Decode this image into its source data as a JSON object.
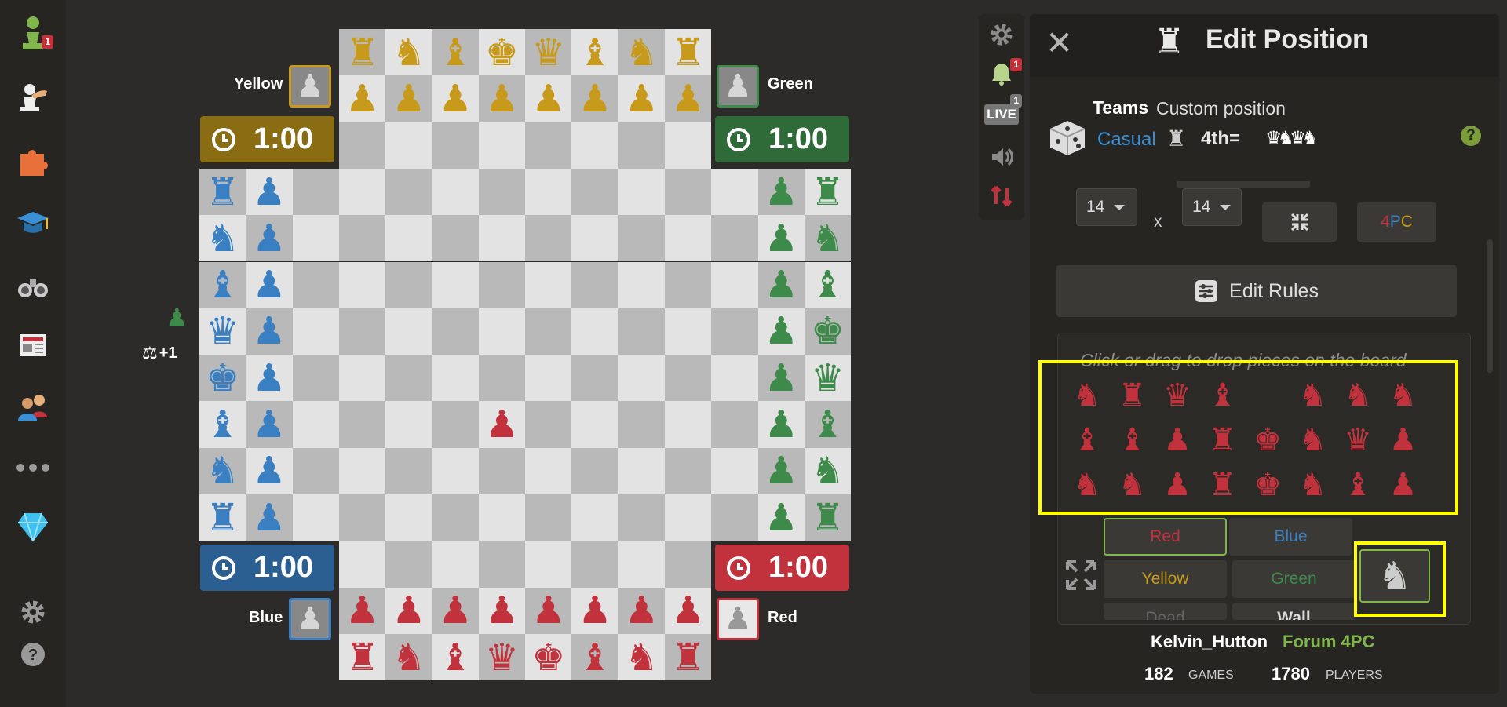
{
  "sidebar": {
    "items": [
      {
        "name": "play",
        "icon": "pawn-icon",
        "badge": "1"
      },
      {
        "name": "puzzles",
        "icon": "hand-piece-icon"
      },
      {
        "name": "puzzle-piece",
        "icon": "puzzle-icon"
      },
      {
        "name": "learn",
        "icon": "graduation-cap-icon"
      },
      {
        "name": "watch",
        "icon": "binoculars-icon"
      },
      {
        "name": "news",
        "icon": "newspaper-icon"
      },
      {
        "name": "social",
        "icon": "people-icon"
      },
      {
        "name": "more",
        "icon": "ellipsis-icon"
      },
      {
        "name": "premium",
        "icon": "diamond-icon"
      },
      {
        "name": "settings",
        "icon": "gear-icon"
      },
      {
        "name": "help",
        "icon": "question-icon"
      }
    ]
  },
  "players": {
    "yellow": {
      "name": "Yellow",
      "time": "1:00"
    },
    "green": {
      "name": "Green",
      "time": "1:00"
    },
    "blue": {
      "name": "Blue",
      "time": "1:00"
    },
    "red": {
      "name": "Red",
      "time": "1:00"
    }
  },
  "material": {
    "advantage": "+1"
  },
  "tools": {
    "notifications_badge": "1",
    "live_label": "LIVE",
    "live_badge": "1"
  },
  "panel": {
    "title": "Edit Position",
    "close": "✕",
    "teams": "Teams",
    "custom": "Custom position",
    "casual": "Casual",
    "rank": "4th",
    "rank_eq": "=",
    "help": "?",
    "rows": "14",
    "cols": "14",
    "x": "x",
    "variant": {
      "p1": "4",
      "p2": "P",
      "p3": "C"
    },
    "edit_rules": "Edit Rules",
    "hint": "Click or drag to drop pieces on the board",
    "colors": {
      "red": "Red",
      "blue": "Blue",
      "yellow": "Yellow",
      "green": "Green",
      "dead": "Dead",
      "wall": "Wall"
    }
  },
  "footer": {
    "user": "Kelvin_Hutton",
    "forum": "Forum 4PC",
    "games_count": "182",
    "games_label": "GAMES",
    "players_count": "1780",
    "players_label": "PLAYERS"
  },
  "colors": {
    "yellow": "#c79a1c",
    "blue": "#3a7fc1",
    "green": "#3e8a4a",
    "red": "#c1323d",
    "highlight": "#ffff00",
    "accent": "#81b64c"
  }
}
